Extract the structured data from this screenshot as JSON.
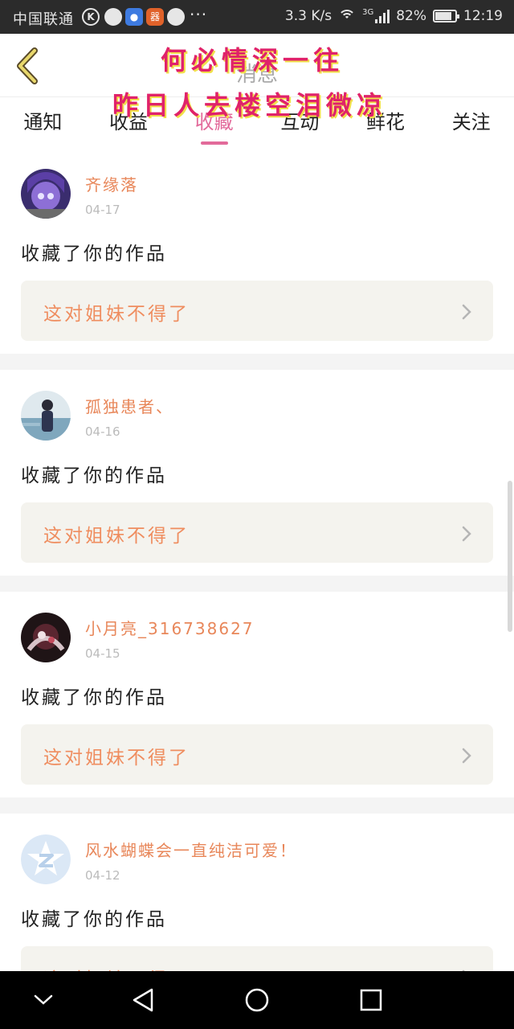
{
  "status_bar": {
    "carrier": "中国联通",
    "icon_ring_label": "K",
    "icon_orange_label": "器",
    "more": "···",
    "net_speed": "3.3 K/s",
    "network": "3G",
    "battery_level": 0.82,
    "battery_text": "82%",
    "time": "12:19"
  },
  "header": {
    "title": "消息",
    "watermark_line1": "何必情深一往",
    "watermark_line2": "昨日人去楼空泪微凉",
    "watermark_color": "#e0226a",
    "accent_color": "#e26a9a"
  },
  "tabs": [
    {
      "label": "通知",
      "active": false
    },
    {
      "label": "收益",
      "active": false
    },
    {
      "label": "收藏",
      "active": true
    },
    {
      "label": "互动",
      "active": false
    },
    {
      "label": "鲜花",
      "active": false
    },
    {
      "label": "关注",
      "active": false
    }
  ],
  "notifications": [
    {
      "user": "齐缘落",
      "date": "04-17",
      "action": "收藏了你的作品",
      "work": "这对姐妹不得了",
      "avatar": "avatar-anime-girl-purple"
    },
    {
      "user": "孤独患者、",
      "date": "04-16",
      "action": "收藏了你的作品",
      "work": "这对姐妹不得了",
      "avatar": "avatar-person-scene"
    },
    {
      "user": "小月亮_316738627",
      "date": "04-15",
      "action": "收藏了你的作品",
      "work": "这对姐妹不得了",
      "avatar": "avatar-dark-art"
    },
    {
      "user": "风水蝴蝶会一直纯洁可爱！",
      "date": "04-12",
      "action": "收藏了你的作品",
      "work": "这对姐妹不得了",
      "avatar": "avatar-default-qzone"
    }
  ],
  "nav_bar": {
    "icons": [
      "chevron-down-icon",
      "back-triangle-icon",
      "home-circle-icon",
      "recents-square-icon"
    ]
  }
}
